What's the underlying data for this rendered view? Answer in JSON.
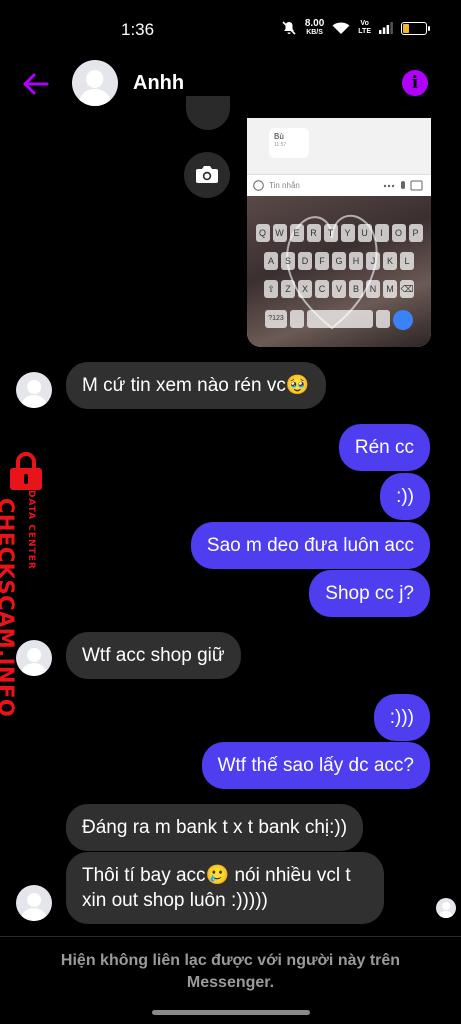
{
  "status_bar": {
    "time": "1:36",
    "network_speed": "8.00",
    "network_unit": "KB/S",
    "volte_top": "Vo",
    "volte_bottom": "LTE",
    "battery_level": 0.3,
    "battery_color": "#f2b632"
  },
  "header": {
    "title": "Anhh",
    "back_icon": "arrow-left-icon",
    "info_icon": "info-icon",
    "accent_color": "#b000ff"
  },
  "attachment": {
    "bubble_text": "Bù",
    "bubble_time": "11:57",
    "input_placeholder": "Tin nhắn",
    "keyboard_rows": [
      [
        "Q",
        "W",
        "E",
        "R",
        "T",
        "Y",
        "U",
        "I",
        "O",
        "P"
      ],
      [
        "A",
        "S",
        "D",
        "F",
        "G",
        "H",
        "J",
        "K",
        "L"
      ],
      [
        "Z",
        "X",
        "C",
        "V",
        "B",
        "N",
        "M"
      ]
    ],
    "keyboard_label": "?123"
  },
  "messages": [
    {
      "side": "in",
      "text": "M cứ tin xem nào rén vc🥹"
    },
    {
      "side": "out",
      "text": "Rén cc"
    },
    {
      "side": "out",
      "text": ":))"
    },
    {
      "side": "out",
      "text": "Sao m deo đưa luôn acc"
    },
    {
      "side": "out",
      "text": "Shop cc j?"
    },
    {
      "side": "in",
      "text": "Wtf acc shop giữ"
    },
    {
      "side": "out",
      "text": ":)))"
    },
    {
      "side": "out",
      "text": "Wtf thế sao lấy dc acc?"
    },
    {
      "side": "in",
      "text": "Đáng ra m bank t x t bank chị:))"
    },
    {
      "side": "in",
      "text": "Thôi tí bay acc🥲 nói nhiều vcl t xin out shop luôn :)))))"
    }
  ],
  "colors": {
    "incoming_bubble": "#303030",
    "outgoing_bubble": "#4f3df0"
  },
  "watermark": {
    "main": "CHECKSCAM.INFO",
    "sub": "DATA CENTER"
  },
  "footer": {
    "notice": "Hiện không liên lạc được với người này trên Messenger."
  }
}
